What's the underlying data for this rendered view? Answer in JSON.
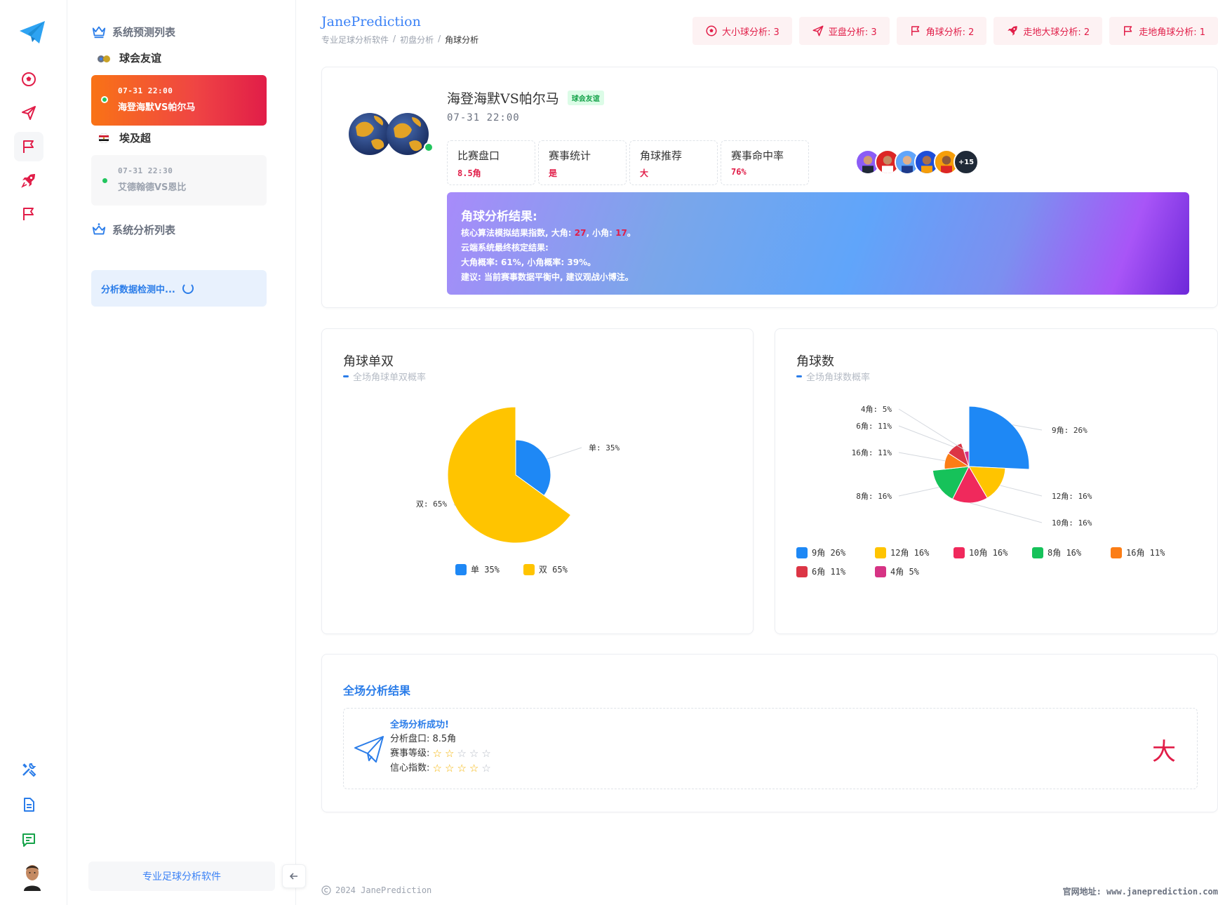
{
  "brand": "JanePrediction",
  "breadcrumbs": [
    "专业足球分析软件",
    "初盘分析",
    "角球分析"
  ],
  "top_pills": [
    {
      "icon": "soccer-ball-icon",
      "label": "大小球分析: 3"
    },
    {
      "icon": "send-icon",
      "label": "亚盘分析: 3"
    },
    {
      "icon": "flag-icon",
      "label": "角球分析: 2"
    },
    {
      "icon": "rocket-icon",
      "label": "走地大球分析: 2"
    },
    {
      "icon": "flag-icon",
      "label": "走地角球分析: 1"
    }
  ],
  "sidebar": {
    "predict_title": "系统预测列表",
    "leagues": [
      {
        "name": "球会友谊",
        "matches": [
          {
            "time": "07-31 22:00",
            "name": "海登海默VS帕尔马",
            "active": true
          }
        ]
      },
      {
        "name": "埃及超",
        "matches": [
          {
            "time": "07-31 22:30",
            "name": "艾德翰德VS恩比",
            "active": false
          }
        ]
      }
    ],
    "analysis_title": "系统分析列表",
    "detecting": "分析数据检测中...",
    "footer": "专业足球分析软件"
  },
  "match": {
    "title": "海登海默VS帕尔马",
    "tag": "球会友谊",
    "time": "07-31 22:00",
    "stats": [
      {
        "label": "比赛盘口",
        "value": "8.5角"
      },
      {
        "label": "赛事统计",
        "value": "是"
      },
      {
        "label": "角球推荐",
        "value": "大"
      },
      {
        "label": "赛事命中率",
        "value": "76%"
      }
    ],
    "avatars_more": "+15",
    "result": {
      "heading": "角球分析结果:",
      "line1_prefix": "核心算法模拟结果指数, 大角:",
      "big": "27",
      "line1_mid": ", 小角:",
      "small": "17",
      "line1_end": "。",
      "line2": "云端系统最终核定结果:",
      "line3": "大角概率: 61%, 小角概率: 39%。",
      "line4": "建议: 当前赛事数据平衡中, 建议观战小博注。"
    }
  },
  "chart1": {
    "title": "角球单双",
    "subtitle": "全场角球单双概率"
  },
  "chart2": {
    "title": "角球数",
    "subtitle": "全场角球数概率"
  },
  "chart_data": [
    {
      "type": "pie",
      "title": "角球单双",
      "subtitle": "全场角球单双概率",
      "categories": [
        "单",
        "双"
      ],
      "values": [
        35,
        65
      ],
      "colors": [
        "#1e88f5",
        "#ffc400"
      ],
      "labels": [
        "单: 35%",
        "双: 65%"
      ],
      "legend_labels": [
        "单 35%",
        "双 65%"
      ],
      "legend": "bottom"
    },
    {
      "type": "pie",
      "title": "角球数",
      "subtitle": "全场角球数概率",
      "categories": [
        "9角",
        "12角",
        "10角",
        "8角",
        "16角",
        "6角",
        "4角"
      ],
      "values": [
        26,
        16,
        16,
        16,
        11,
        11,
        5
      ],
      "colors": [
        "#1e88f5",
        "#ffc400",
        "#f0295c",
        "#16c25a",
        "#fb7d16",
        "#dc3545",
        "#d63384"
      ],
      "labels": [
        "9角: 26%",
        "12角: 16%",
        "10角: 16%",
        "8角: 16%",
        "16角: 11%",
        "6角: 11%",
        "4角: 5%"
      ],
      "legend_labels": [
        "9角 26%",
        "12角 16%",
        "10角 16%",
        "8角 16%",
        "16角 11%",
        "6角 11%",
        "4角 5%"
      ],
      "legend": "bottom"
    }
  ],
  "full": {
    "title": "全场分析结果",
    "ok": "全场分析成功!",
    "handicap": "分析盘口: 8.5角",
    "level_label": "赛事等级:",
    "level_stars": 2,
    "confidence_label": "信心指数:",
    "confidence_stars": 4,
    "tip": "大"
  },
  "footer": {
    "left": "2024 JanePrediction",
    "right": "官网地址: www.janeprediction.com"
  }
}
